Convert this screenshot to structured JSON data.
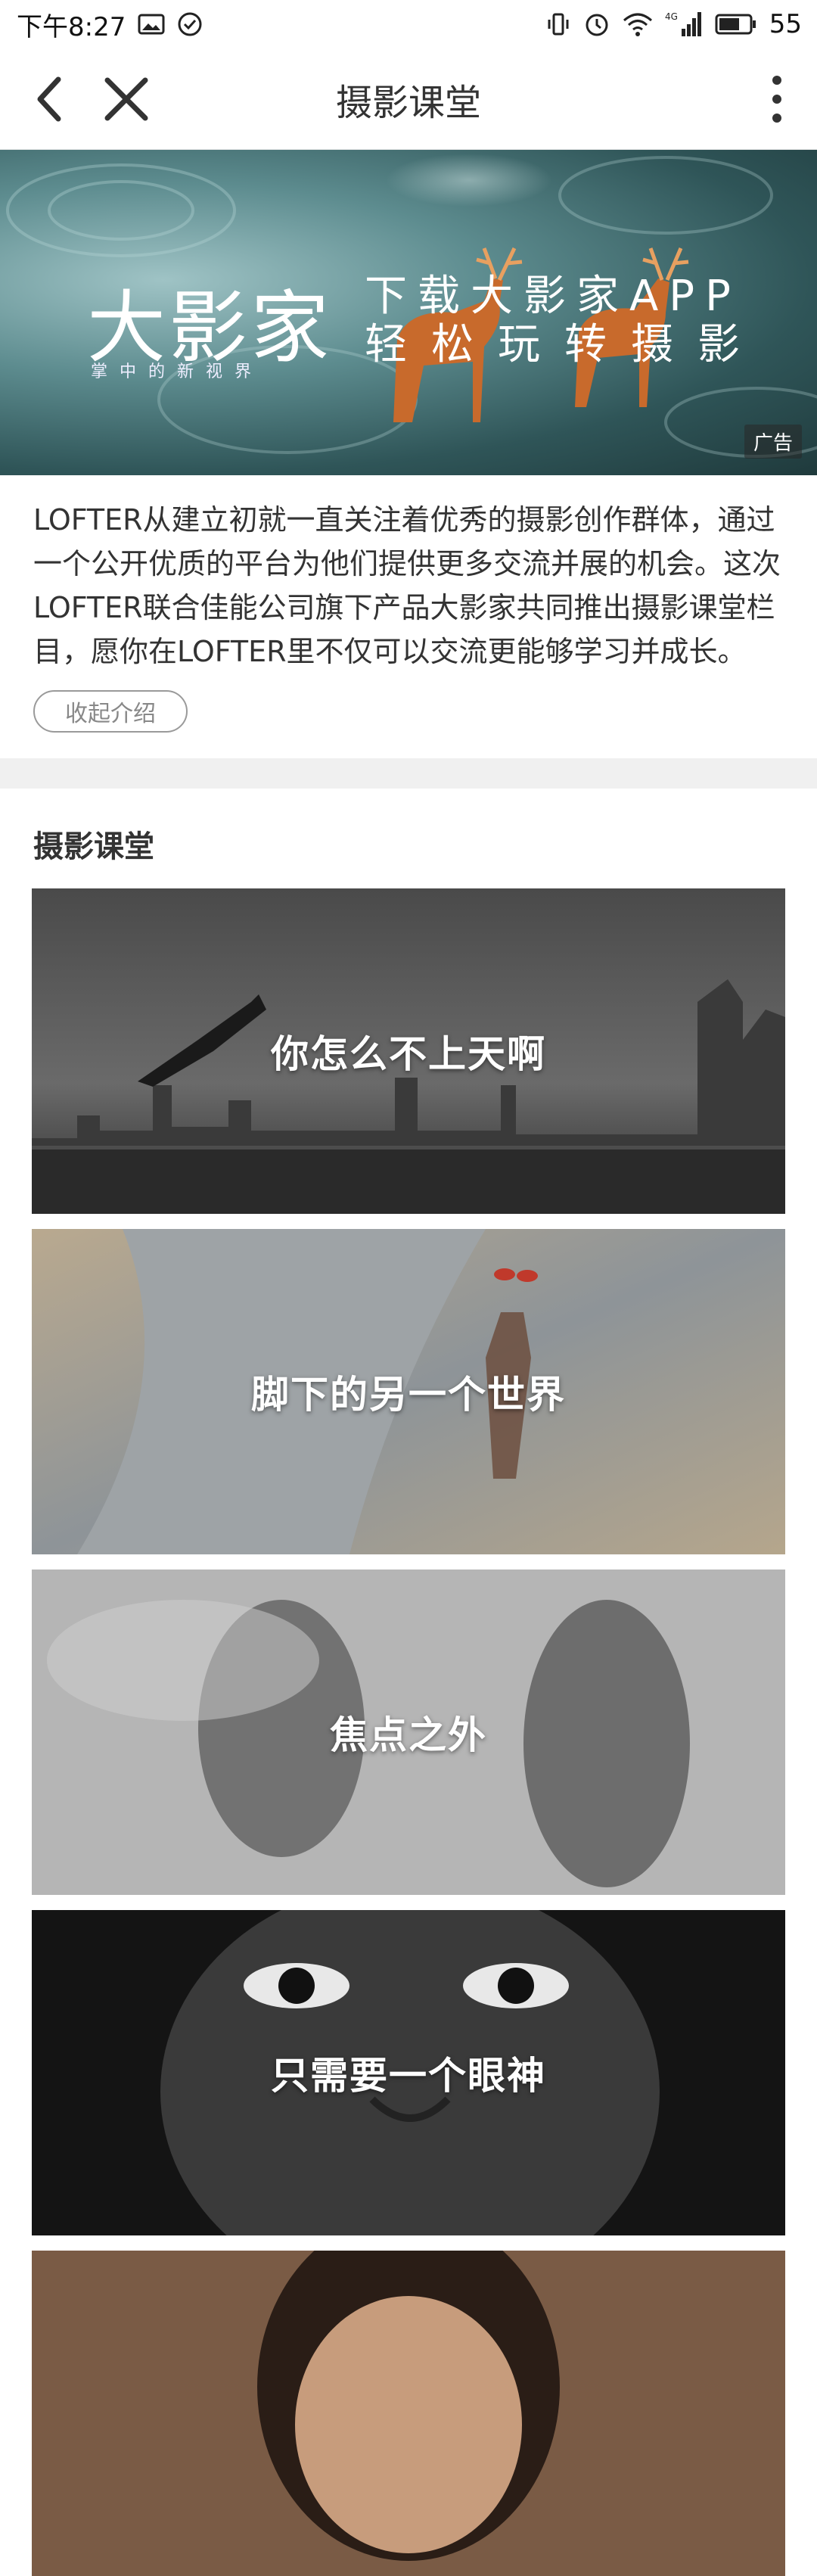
{
  "status_bar": {
    "time": "下午8:27",
    "network": "4G",
    "battery": "55"
  },
  "nav": {
    "title": "摄影课堂"
  },
  "banner": {
    "brand": "大影家",
    "brand_sub": "掌中的新视界",
    "promo_line1": "下载大影家APP",
    "promo_line2": "轻松玩转摄影",
    "ad_label": "广告"
  },
  "intro": {
    "text": "LOFTER从建立初就一直关注着优秀的摄影创作群体，通过一个公开优质的平台为他们提供更多交流并展的机会。这次LOFTER联合佳能公司旗下产品大影家共同推出摄影课堂栏目，愿你在LOFTER里不仅可以交流更能够学习并成长。",
    "collapse_label": "收起介绍"
  },
  "section": {
    "title": "摄影课堂"
  },
  "cards": [
    {
      "label": "你怎么不上天啊"
    },
    {
      "label": "脚下的另一个世界"
    },
    {
      "label": "焦点之外"
    },
    {
      "label": "只需要一个眼神"
    },
    {
      "label": ""
    }
  ],
  "colors": {
    "accent_red": "#e23a3a",
    "divider": "#f0f0f0"
  }
}
